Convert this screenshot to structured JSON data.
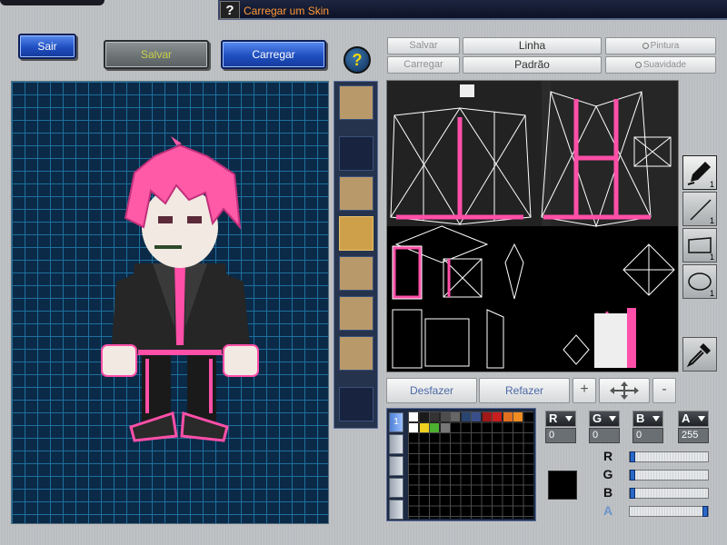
{
  "window": {
    "title": "Carregar um Skin",
    "help_glyph": "?"
  },
  "toolbar": {
    "exit_label": "Sair",
    "save_label": "Salvar",
    "load_label": "Carregar",
    "help_glyph": "?"
  },
  "editor_options": {
    "save_label": "Salvar",
    "load_label": "Carregar",
    "mode_line": "Linha",
    "mode_default": "Padrão",
    "paint_label": "Pintura",
    "smooth_label": "Suavidade"
  },
  "slots": [
    {
      "name": "head",
      "type": "face"
    },
    {
      "name": "empty-1",
      "type": "empty"
    },
    {
      "name": "hat",
      "type": "face"
    },
    {
      "name": "body",
      "type": "active"
    },
    {
      "name": "face-1",
      "type": "face"
    },
    {
      "name": "face-2",
      "type": "face"
    },
    {
      "name": "face-3",
      "type": "face"
    },
    {
      "name": "empty-2",
      "type": "empty"
    }
  ],
  "tools": {
    "pencil_size": "1",
    "line_size": "1",
    "rect_size": "1",
    "ellipse_size": "1",
    "icons": [
      "pencil-icon",
      "line-icon",
      "rectangle-icon",
      "ellipse-icon",
      "eyedropper-icon"
    ]
  },
  "history": {
    "undo_label": "Desfazer",
    "redo_label": "Refazer",
    "zoom_out_glyph": "+",
    "zoom_in_glyph": "-"
  },
  "palette": {
    "active_tab": "1",
    "colors": [
      "#ffffff",
      "#1a1a1a",
      "#333333",
      "#4d4d4d",
      "#666666",
      "#2a4470",
      "#3a4f8a",
      "#a01818",
      "#c81e1e",
      "#e07020",
      "#f08c20",
      "#ffffff",
      "#f0d020",
      "#4caf30",
      "#777777"
    ],
    "current_color": "#000000"
  },
  "color_channels": {
    "r": {
      "label": "R",
      "value": "0",
      "level": 0
    },
    "g": {
      "label": "G",
      "value": "0",
      "level": 0
    },
    "b": {
      "label": "B",
      "value": "0",
      "level": 0
    },
    "a": {
      "label": "A",
      "value": "255",
      "level": 1
    }
  }
}
